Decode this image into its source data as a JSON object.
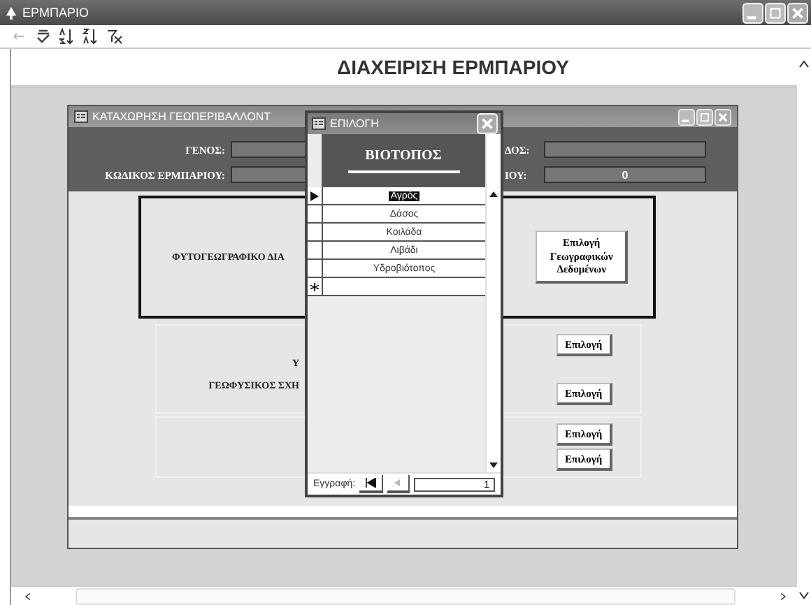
{
  "window": {
    "title": "ΕΡΜΠΑΡΙΟ"
  },
  "form_title": "ΔΙΑΧΕΙΡΙΣΗ ΕΡΜΠΑΡΙΟΥ",
  "entry_window": {
    "title": "ΚΑΤΑΧΩΡΗΣΗ ΓΕΩΠΕΡΙΒΑΛΛΟΝΤ",
    "fields_left": [
      {
        "label": "ΓΕΝΟΣ:"
      },
      {
        "label": "ΚΩΔΙΚΟΣ ΕΡΜΠΑΡΙΟΥ:"
      }
    ],
    "fields_right": [
      {
        "label": "ΔΟΣ:"
      },
      {
        "label": "ΙΟΥ:",
        "value": "0"
      }
    ],
    "phyto_section": {
      "label": "ΦΥΤΟΓΕΩΓΡΑΦΙΚΟ ΔΙΑ",
      "button": "Επιλογή Γεωγραφικών Δεδομένων"
    },
    "geo_section": {
      "labels": [
        "Υ",
        "ΓΕΩΦΥΣΙΚΟΣ ΣΧΗ"
      ],
      "buttons": [
        "Επιλογή",
        "Επιλογή"
      ]
    },
    "extra_section": {
      "buttons": [
        "Επιλογή",
        "Επιλογή"
      ]
    }
  },
  "picker": {
    "title": "ΕΠΙΛΟΓΗ",
    "column": "ΒΙΟΤΟΠΟΣ",
    "rows": [
      {
        "value": "Αγρός",
        "selected": true
      },
      {
        "value": "Δάσος",
        "selected": false
      },
      {
        "value": "Κοιλάδα",
        "selected": false
      },
      {
        "value": "Λιβάδι",
        "selected": false
      },
      {
        "value": "Υδροβιότοπος",
        "selected": false
      }
    ],
    "record_label": "Εγγραφή:",
    "record_number": "1"
  }
}
